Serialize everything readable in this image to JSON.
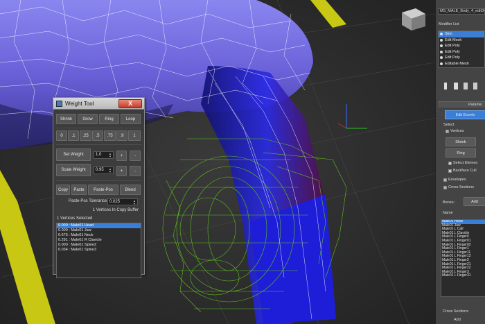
{
  "command_panel": {
    "object_name": "MS_MALE_Body_4_edit06",
    "modifier_list_label": "Modifier List",
    "stack": [
      {
        "label": "Skin",
        "selected": true
      },
      {
        "label": "Edit Mesh",
        "selected": false
      },
      {
        "label": "Edit Poly",
        "selected": false
      },
      {
        "label": "Edit Poly",
        "selected": false
      },
      {
        "label": "Edit Poly",
        "selected": false
      },
      {
        "label": "Editable Mesh",
        "selected": false
      }
    ],
    "rollout_title": "Parame",
    "edit_envelopes_label": "Edit Envelo",
    "select_label": "Select",
    "vertices_label": "Vertices",
    "shrink_label": "Shrink",
    "ring_label": "Ring",
    "select_element_label": "Select Elemen",
    "backface_label": "Backface Cull",
    "envelopes_label": "Envelopes",
    "cross_sections_label": "Cross Sections",
    "bones_label": "Bones:",
    "add_label": "Add",
    "name_label": "Name",
    "bones": [
      "Male01 Head",
      "Male01 Jaw",
      "Male01 L Calf",
      "Male01 L Clavicle",
      "Male01 L Finger0",
      "Male01 L Finger01",
      "Male01 L Finger02",
      "Male01 L Finger1",
      "Male01 L Finger11",
      "Male01 L Finger12",
      "Male01 L Finger2",
      "Male01 L Finger21",
      "Male01 L Finger22",
      "Male01 L Finger3",
      "Male01 L Finger31"
    ],
    "cross_sections_footer": "Cross Sections",
    "footer_add_label": "Add"
  },
  "weight_tool": {
    "title": "Weight Tool",
    "close_label": "X",
    "row1": [
      "Shrink",
      "Grow",
      "Ring",
      "Loop"
    ],
    "presets": [
      "0",
      ".1",
      ".25",
      ".5",
      ".75",
      ".9",
      "1"
    ],
    "set_weight_label": "Set Weight",
    "set_weight_value": "1.0",
    "scale_weight_label": "Scale Weight",
    "scale_weight_value": "0.95",
    "plus": "+",
    "minus": "-",
    "row_copy": [
      "Copy",
      "Paste",
      "Paste-Pos",
      "Blend"
    ],
    "paste_tolerance_label": "Paste-Pos Tolerance",
    "paste_tolerance_value": "0.025",
    "copy_buffer_text": "1 Vertices In Copy Buffer",
    "selected_text": "1 Vertices Selected",
    "weights": [
      "0.000 : Male01 Head",
      "0.000 : Male01 Jaw",
      "0.675 : Male01 Neck",
      "0.291 : Male01 R Clavicle",
      "0.000 : Male01 Spine2",
      "0.034 : Male01 Spine3"
    ],
    "selected_index": 0
  },
  "colors": {
    "selection_blue": "#3a7fd5",
    "body_purple": "#6b63d6",
    "wire_green": "#5ec21c",
    "panel_gray": "#444444"
  }
}
